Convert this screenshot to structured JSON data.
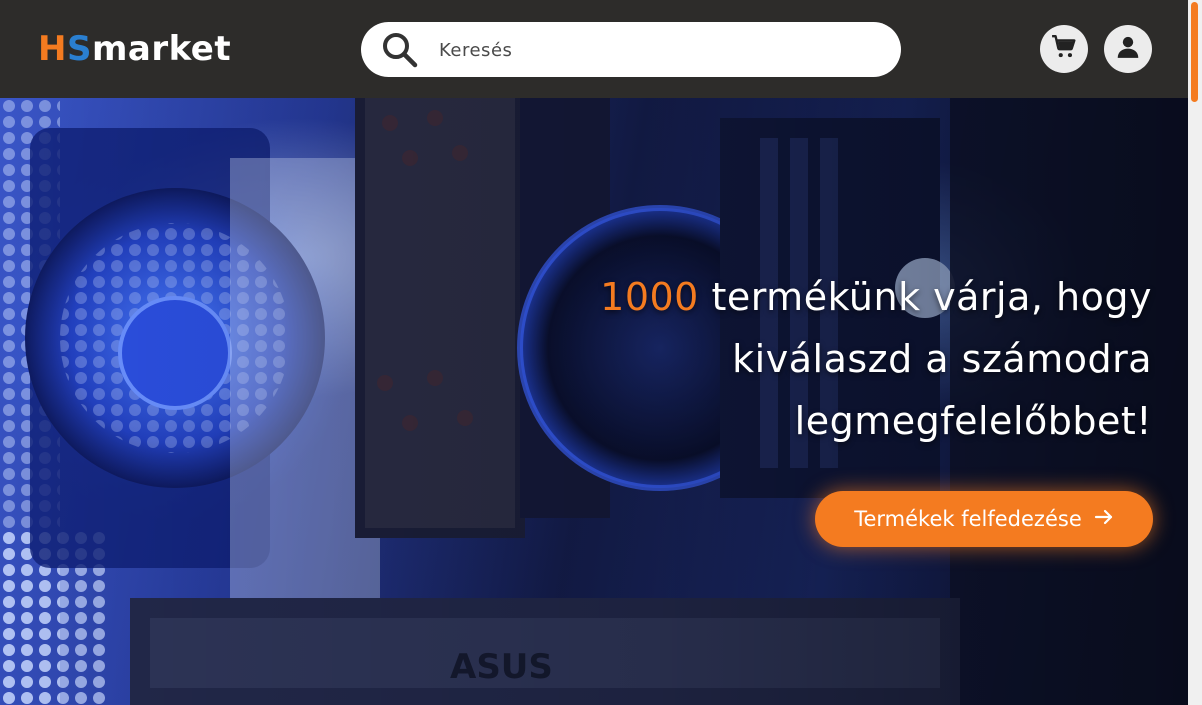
{
  "header": {
    "logo": {
      "h": "H",
      "s": "S",
      "rest": "market"
    },
    "search": {
      "placeholder": "Keresés",
      "icon": "search-icon"
    },
    "cart_icon": "cart-icon",
    "user_icon": "user-icon"
  },
  "hero": {
    "headline_number": "1000",
    "headline_line1": " termékünk várja, hogy",
    "headline_line2": "kiválaszd a számodra",
    "headline_line3": "legmegfelelőbbet!",
    "cta_label": "Termékek felfedezése",
    "cta_icon": "arrow-right-icon"
  },
  "colors": {
    "accent": "#f47b20",
    "logo_s": "#2a7fd0",
    "header_bg": "#2d2c2a"
  }
}
